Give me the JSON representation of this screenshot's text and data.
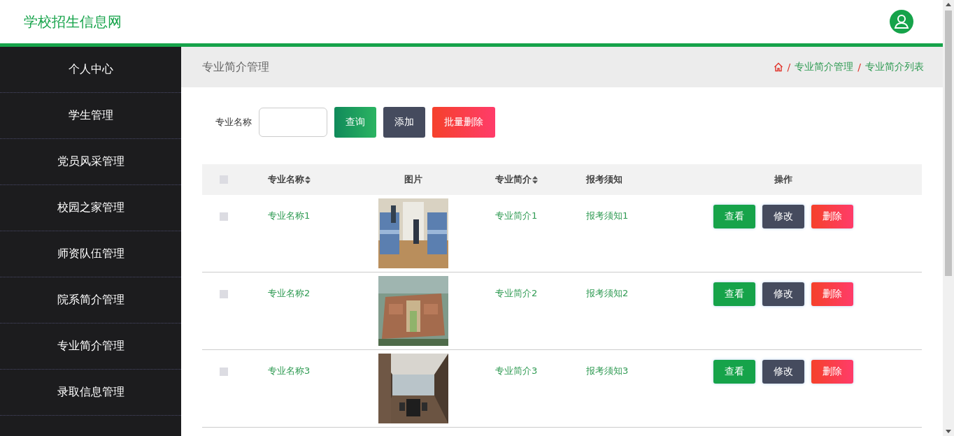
{
  "header": {
    "site_title": "学校招生信息网"
  },
  "sidebar": {
    "items": [
      {
        "label": "个人中心"
      },
      {
        "label": "学生管理"
      },
      {
        "label": "党员风采管理"
      },
      {
        "label": "校园之家管理"
      },
      {
        "label": "师资队伍管理"
      },
      {
        "label": "院系简介管理"
      },
      {
        "label": "专业简介管理"
      },
      {
        "label": "录取信息管理"
      }
    ]
  },
  "page_title": "专业简介管理",
  "breadcrumb": [
    {
      "separator": "/",
      "label": "专业简介管理"
    },
    {
      "separator": "/",
      "label": "专业简介列表"
    }
  ],
  "search": {
    "label": "专业名称",
    "buttons": [
      "查询",
      "添加",
      "批量删除"
    ]
  },
  "table": {
    "header_checked": false,
    "columns": [
      {
        "label": "专业名称",
        "sortable": true
      },
      {
        "label": "图片",
        "sortable": false
      },
      {
        "label": "专业简介",
        "sortable": true
      },
      {
        "label": "报考须知",
        "sortable": false
      },
      {
        "label": "操作",
        "sortable": false
      }
    ],
    "rows": [
      {
        "checked": false,
        "name": "专业名称1",
        "intro": "专业简介1",
        "notice": "报考须知1",
        "actions": [
          "查看",
          "修改",
          "删除"
        ]
      },
      {
        "checked": false,
        "name": "专业名称2",
        "intro": "专业简介2",
        "notice": "报考须知2",
        "actions": [
          "查看",
          "修改",
          "删除"
        ]
      },
      {
        "checked": false,
        "name": "专业名称3",
        "intro": "专业简介3",
        "notice": "报考须知3",
        "actions": [
          "查看",
          "修改",
          "删除"
        ]
      }
    ]
  }
}
